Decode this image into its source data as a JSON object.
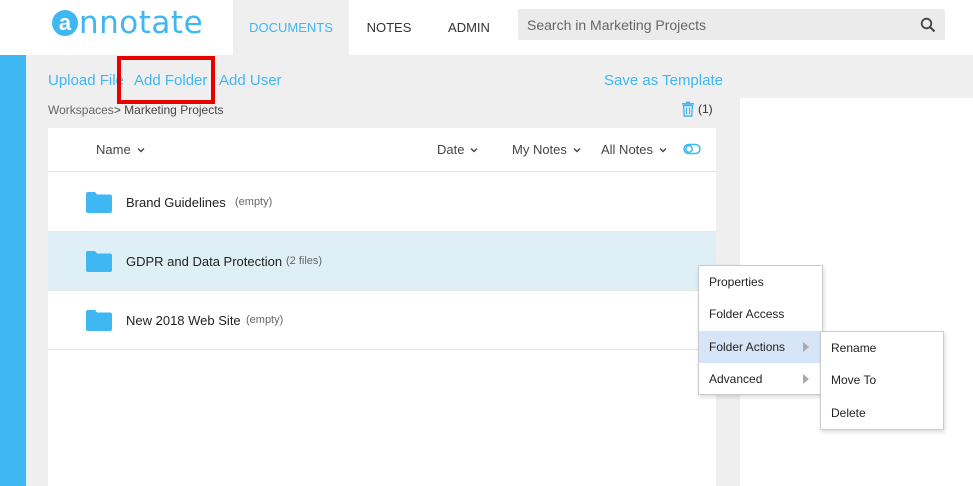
{
  "app": {
    "logo_letter": "a",
    "logo_text": "nnotate",
    "accent_color": "#3fb7f2",
    "highlight_color": "#e60000"
  },
  "topnav": {
    "tabs": [
      {
        "label": "DOCUMENTS",
        "active": true
      },
      {
        "label": "NOTES",
        "active": false
      },
      {
        "label": "ADMIN",
        "active": false
      }
    ]
  },
  "search": {
    "placeholder": "Search in Marketing Projects",
    "icon": "search-icon"
  },
  "actions": {
    "upload_file": "Upload File",
    "add_folder": "Add Folder",
    "add_user": "Add User",
    "save_as_template": "Save as Template"
  },
  "breadcrumb": {
    "root": "Workspaces",
    "separator": ">",
    "current": "Marketing Projects"
  },
  "trash": {
    "icon": "trash-icon",
    "count": "(1)"
  },
  "table": {
    "columns": {
      "name": "Name",
      "date": "Date",
      "my_notes": "My Notes",
      "all_notes": "All Notes"
    },
    "rows": [
      {
        "name": "Brand Guidelines",
        "count": "(empty)",
        "selected": false
      },
      {
        "name": "GDPR and Data Protection",
        "count": "(2 files)",
        "selected": true
      },
      {
        "name": "New 2018 Web Site",
        "count": "(empty)",
        "selected": false
      }
    ]
  },
  "context_menu": {
    "items": [
      {
        "label": "Properties",
        "has_submenu": false
      },
      {
        "label": "Folder Access",
        "has_submenu": false
      },
      {
        "label": "Folder Actions",
        "has_submenu": true,
        "hover": true
      },
      {
        "label": "Advanced",
        "has_submenu": true
      }
    ],
    "submenu": [
      {
        "label": "Rename"
      },
      {
        "label": "Move To"
      },
      {
        "label": "Delete"
      }
    ]
  }
}
